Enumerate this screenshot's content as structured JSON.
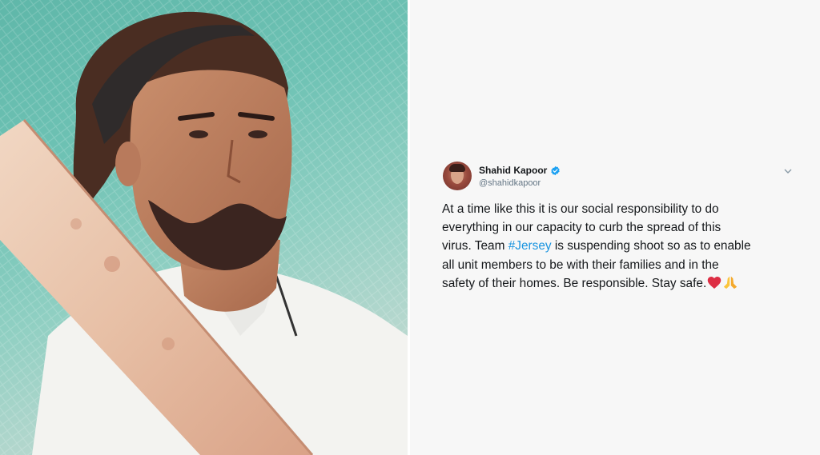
{
  "photo": {
    "description_icon": "cricket-player-photo"
  },
  "tweet": {
    "user_name": "Shahid Kapoor",
    "user_handle": "@shahidkapoor",
    "verified": true,
    "text_lines": [
      "At a time like this it is our social responsibility to do",
      "everything in our capacity to curb the spread of this",
      "virus. Team ",
      "all unit members to be with their families and in the",
      "safety of their homes. Be responsible. Stay safe."
    ],
    "hashtag": "#Jersey",
    "after_hashtag": " is suspending shoot so as to enable",
    "emojis": [
      "red-heart-icon",
      "folded-hands-icon"
    ]
  },
  "colors": {
    "hashtag": "#1b95e0",
    "verified": "#1da1f2",
    "text": "#14171a",
    "handle": "#657786",
    "net_green": "#6ec2b4"
  }
}
